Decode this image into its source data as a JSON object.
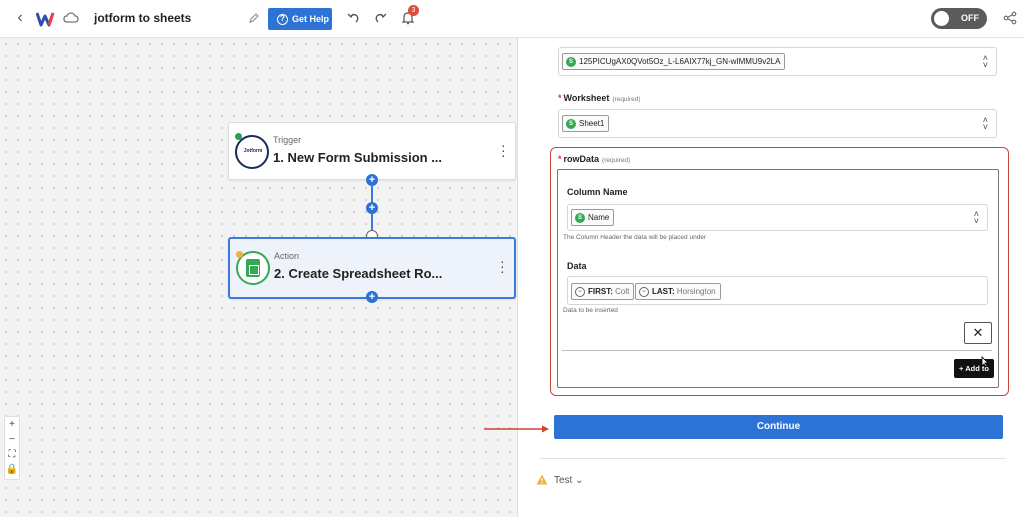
{
  "header": {
    "title": "jotform to sheets",
    "help_label": "Get Help",
    "notification_count": "3",
    "toggle_label": "OFF"
  },
  "canvas": {
    "trigger": {
      "type": "Trigger",
      "name": "1. New Form Submission ...",
      "app_label": "Jotform"
    },
    "action": {
      "type": "Action",
      "name": "2. Create Spreadsheet Ro..."
    }
  },
  "panel": {
    "spreadsheet": {
      "value": "125PICUgAX0QVot5Oz_L-L6AIX77kj_GN-wIMMU9v2LA"
    },
    "worksheet": {
      "label": "Worksheet",
      "required": "(required)",
      "value": "Sheet1"
    },
    "rowdata": {
      "label": "rowData",
      "required": "(required)",
      "column_name_label": "Column Name",
      "column_value": "Name",
      "column_hint": "The Column Header the data will be placed under",
      "data_label": "Data",
      "data_chips": [
        {
          "key": "FIRST:",
          "value": "Colt"
        },
        {
          "key": "LAST:",
          "value": "Horsington"
        }
      ],
      "data_hint": "Data to be inserted",
      "add_label": "+ Add to"
    },
    "continue_label": "Continue",
    "test_label": "Test"
  },
  "colors": {
    "accent": "#2d73d6",
    "highlight": "#c9463a",
    "sheets_green": "#34a853"
  }
}
